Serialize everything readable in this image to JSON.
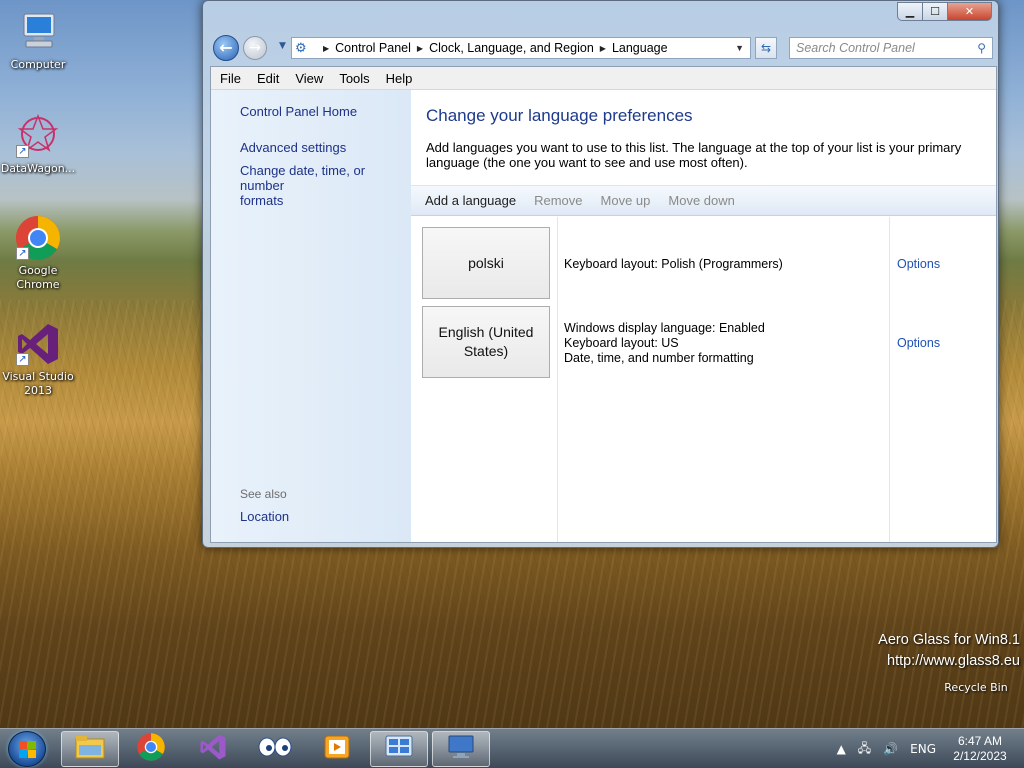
{
  "desktop": {
    "icons": [
      {
        "label": "Computer",
        "icon": "computer-icon"
      },
      {
        "label": "DataWagon...",
        "icon": "datawagon-icon"
      },
      {
        "label": "Google Chrome",
        "icon": "chrome-icon"
      },
      {
        "label": "Visual Studio 2013",
        "icon": "visual-studio-icon"
      }
    ],
    "recycle_bin": "Recycle Bin",
    "watermark": {
      "line1": "Aero Glass for Win8.1",
      "line2": "http://www.glass8.eu"
    }
  },
  "window": {
    "controls": {
      "minimize": "▁",
      "maximize": "☐",
      "close": "✕"
    },
    "breadcrumb": [
      "Control Panel",
      "Clock, Language, and Region",
      "Language"
    ],
    "search_placeholder": "Search Control Panel",
    "menu": [
      "File",
      "Edit",
      "View",
      "Tools",
      "Help"
    ],
    "left_pane": {
      "home": "Control Panel Home",
      "advanced": "Advanced settings",
      "change_date_line1": "Change date, time, or number",
      "change_date_line2": "formats",
      "see_also": "See also",
      "location": "Location"
    },
    "main": {
      "title": "Change your language preferences",
      "description": "Add languages you want to use to this list. The language at the top of your list is your primary language (the one you want to see and use most often).",
      "toolbar": {
        "add": "Add a language",
        "remove": "Remove",
        "move_up": "Move up",
        "move_down": "Move down"
      },
      "languages": [
        {
          "name": "polski",
          "info": [
            "Keyboard layout: Polish (Programmers)"
          ],
          "options": "Options"
        },
        {
          "name": "English (United States)",
          "info": [
            "Windows display language: Enabled",
            "Keyboard layout: US",
            "Date, time, and number formatting"
          ],
          "options": "Options"
        }
      ]
    }
  },
  "taskbar": {
    "tray": {
      "input_lang": "ENG",
      "time": "6:47 AM",
      "date": "2/12/2023"
    }
  }
}
